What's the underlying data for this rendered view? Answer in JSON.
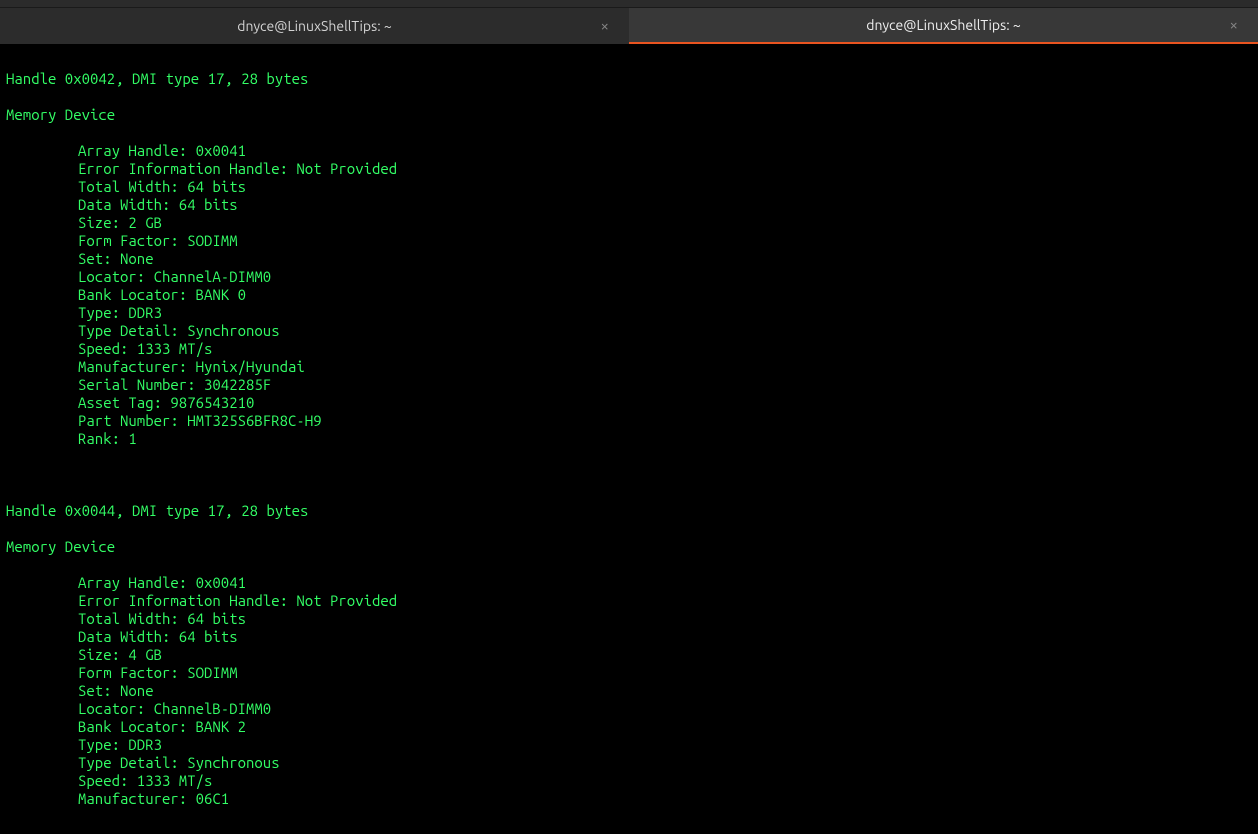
{
  "tabs": [
    {
      "title": "dnyce@LinuxShellTips: ~",
      "active": false
    },
    {
      "title": "dnyce@LinuxShellTips: ~",
      "active": true
    }
  ],
  "terminal_output": {
    "block1_header": "Handle 0x0042, DMI type 17, 28 bytes",
    "block1_title": "Memory Device",
    "block1": [
      "Array Handle: 0x0041",
      "Error Information Handle: Not Provided",
      "Total Width: 64 bits",
      "Data Width: 64 bits",
      "Size: 2 GB",
      "Form Factor: SODIMM",
      "Set: None",
      "Locator: ChannelA-DIMM0",
      "Bank Locator: BANK 0",
      "Type: DDR3",
      "Type Detail: Synchronous",
      "Speed: 1333 MT/s",
      "Manufacturer: Hynix/Hyundai",
      "Serial Number: 3042285F",
      "Asset Tag: 9876543210",
      "Part Number: HMT325S6BFR8C-H9",
      "Rank: 1"
    ],
    "block2_header": "Handle 0x0044, DMI type 17, 28 bytes",
    "block2_title": "Memory Device",
    "block2": [
      "Array Handle: 0x0041",
      "Error Information Handle: Not Provided",
      "Total Width: 64 bits",
      "Data Width: 64 bits",
      "Size: 4 GB",
      "Form Factor: SODIMM",
      "Set: None",
      "Locator: ChannelB-DIMM0",
      "Bank Locator: BANK 2",
      "Type: DDR3",
      "Type Detail: Synchronous",
      "Speed: 1333 MT/s",
      "Manufacturer: 06C1"
    ]
  }
}
